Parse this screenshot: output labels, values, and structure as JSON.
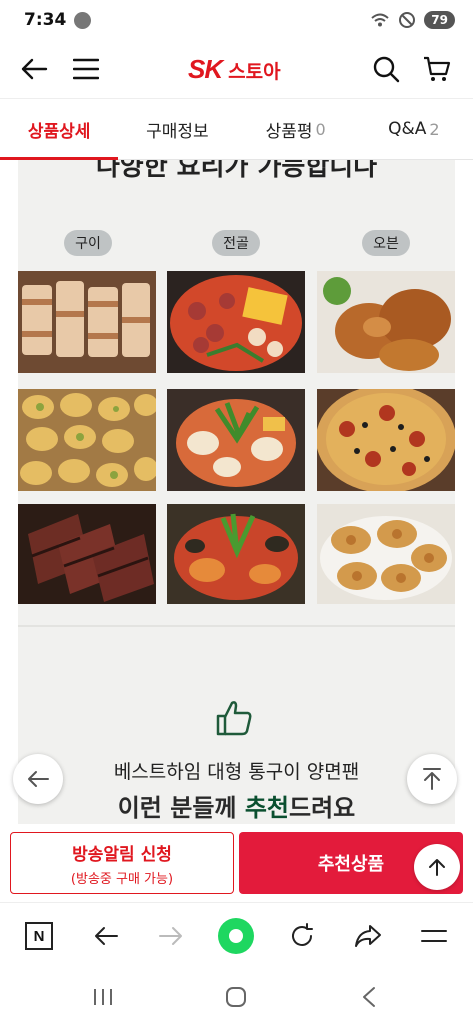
{
  "status": {
    "time": "7:34",
    "battery": "79"
  },
  "header": {
    "brand_logo": "SK",
    "brand_name": "스토아"
  },
  "tabs": [
    {
      "label": "상품상세",
      "count": ""
    },
    {
      "label": "구매정보",
      "count": ""
    },
    {
      "label": "상품평",
      "count": "0"
    },
    {
      "label": "Q&A",
      "count": "2"
    }
  ],
  "content": {
    "headline_partial": "다양한 요리가 가능합니다",
    "categories": [
      "구이",
      "전골",
      "오븐"
    ],
    "subtitle": "베스트하임 대형 통구이 양면팬",
    "title_prefix": "이런 분들께 ",
    "title_highlight": "추천",
    "title_suffix": "드려요"
  },
  "cta": {
    "notify_label": "방송알림 신청",
    "notify_sub": "(방송중 구매 가능)",
    "recommend_label": "추천상품"
  },
  "browser": {
    "home_label": "N"
  },
  "colors": {
    "accent": "#e0171f",
    "cta_red": "#e31b3b",
    "green_dot": "#1ed760"
  }
}
